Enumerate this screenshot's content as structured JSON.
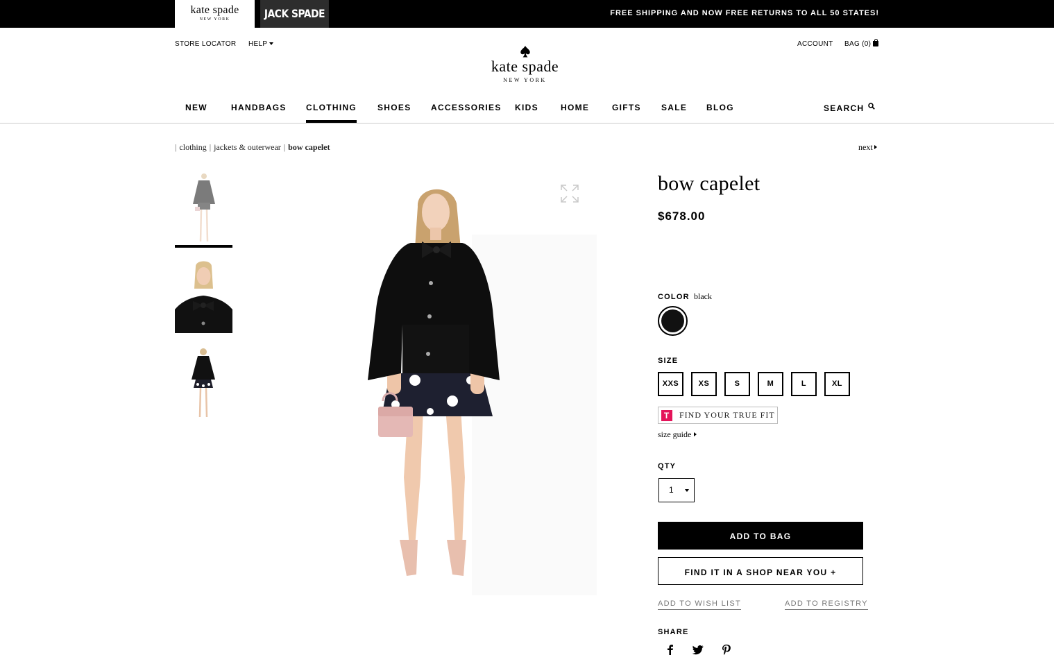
{
  "brands": {
    "kate_spade": {
      "name": "kate spade",
      "sub": "NEW YORK"
    },
    "jack_spade": {
      "name": "JACK SPADE"
    }
  },
  "promo": "FREE SHIPPING AND NOW FREE RETURNS TO ALL 50 STATES!",
  "header": {
    "store_locator": "STORE LOCATOR",
    "help": "HELP",
    "account": "ACCOUNT",
    "bag": "BAG (0)",
    "logo": {
      "name": "kate spade",
      "sub": "NEW YORK"
    }
  },
  "nav": {
    "items": [
      "NEW",
      "HANDBAGS",
      "CLOTHING",
      "SHOES",
      "ACCESSORIES",
      "KIDS",
      "HOME",
      "GIFTS",
      "SALE",
      "BLOG"
    ],
    "active": "CLOTHING",
    "search": "SEARCH"
  },
  "breadcrumb": [
    "clothing",
    "jackets & outerwear",
    "bow capelet"
  ],
  "next_label": "next",
  "product": {
    "title": "bow capelet",
    "price": "$678.00",
    "color_label": "COLOR",
    "color_value": "black",
    "swatch_color": "#111111",
    "size_label": "SIZE",
    "sizes": [
      "XXS",
      "XS",
      "S",
      "M",
      "L",
      "XL"
    ],
    "truefit_label": "FIND YOUR TRUE FIT",
    "truefit_logo": "T",
    "size_guide": "size guide",
    "qty_label": "QTY",
    "qty_value": "1",
    "add_to_bag": "ADD TO BAG",
    "find_in_shop": "FIND IT IN A SHOP NEAR YOU +",
    "add_to_wish_list": "ADD TO WISH LIST",
    "add_to_registry": "ADD TO REGISTRY",
    "share_label": "SHARE",
    "share_icons": [
      "facebook-icon",
      "twitter-icon",
      "pinterest-icon"
    ]
  },
  "colors": {
    "black": "#000000",
    "jack_spade_bg": "#2d2d2d",
    "truefit_pink": "#e4145a",
    "divider": "#cccccc"
  }
}
